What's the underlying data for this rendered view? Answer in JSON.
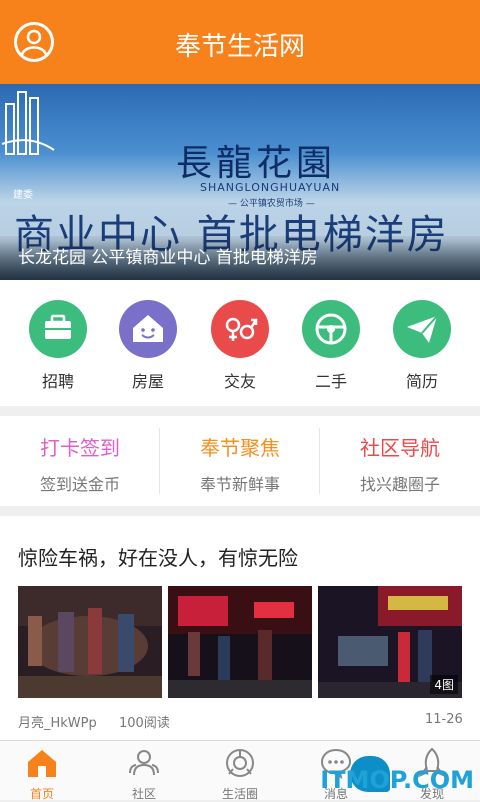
{
  "header": {
    "title": "奉节生活网"
  },
  "banner": {
    "logo_text": "建委",
    "brand": "長龍花園",
    "pinyin": "SHANGLONGHUAYUAN",
    "market": "— 公平镇农贸市场 —",
    "slogan": "商业中心  首批电梯洋房",
    "caption": "长龙花园 公平镇商业中心 首批电梯洋房"
  },
  "quick_icons": [
    {
      "label": "招聘",
      "color": "#3dbd7d",
      "icon": "briefcase-icon"
    },
    {
      "label": "房屋",
      "color": "#7a6fc9",
      "icon": "house-icon"
    },
    {
      "label": "交友",
      "color": "#e94b4b",
      "icon": "gender-icon"
    },
    {
      "label": "二手",
      "color": "#3dbd7d",
      "icon": "steering-wheel-icon"
    },
    {
      "label": "简历",
      "color": "#3dbd7d",
      "icon": "paper-plane-icon"
    }
  ],
  "features": [
    {
      "title": "打卡签到",
      "sub": "签到送金币",
      "color": "#e35ec7"
    },
    {
      "title": "奉节聚焦",
      "sub": "奉节新鲜事",
      "color": "#f29020"
    },
    {
      "title": "社区导航",
      "sub": "找兴趣圈子",
      "color": "#e84b4b"
    }
  ],
  "article": {
    "title": "惊险车祸，好在没人，有惊无险",
    "image_count": "4图",
    "author": "月亮_HkWPp",
    "reads": "100阅读",
    "date": "11-26"
  },
  "tabs": [
    {
      "label": "首页",
      "icon": "home-icon"
    },
    {
      "label": "社区",
      "icon": "community-icon"
    },
    {
      "label": "生活圈",
      "icon": "life-circle-icon"
    },
    {
      "label": "消息",
      "icon": "message-icon"
    },
    {
      "label": "发现",
      "icon": "discover-icon"
    }
  ],
  "watermark": "ITMOP.COM",
  "colors": {
    "accent": "#f7821c"
  }
}
